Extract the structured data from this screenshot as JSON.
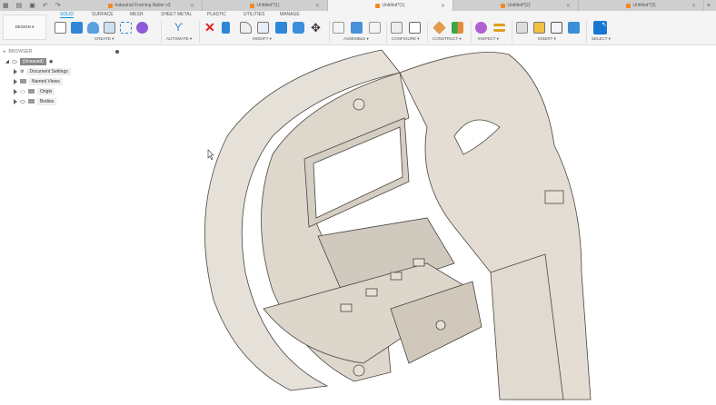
{
  "tabs": [
    {
      "label": "Industrial Framing Nailer v3",
      "active": false
    },
    {
      "label": "Untitled*(1)",
      "active": false
    },
    {
      "label": "Untitled*(1)",
      "active": true
    },
    {
      "label": "Untitled*(2)",
      "active": false
    },
    {
      "label": "Untitled*(3)",
      "active": false
    }
  ],
  "toolbar": {
    "workspace": "DESIGN ▾",
    "tabs": [
      "SOLID",
      "SURFACE",
      "MESH",
      "SHEET METAL",
      "PLASTIC",
      "UTILITIES",
      "MANAGE"
    ],
    "groups": [
      "CREATE ▾",
      "AUTOMATE ▾",
      "MODIFY ▾",
      "ASSEMBLE ▾",
      "CONFIGURE ▾",
      "CONSTRUCT ▾",
      "INSPECT ▾",
      "INSERT ▾",
      "SELECT ▾"
    ]
  },
  "browser": {
    "title": "BROWSER",
    "root": "(Unsaved)",
    "items": [
      "Document Settings",
      "Named Views",
      "Origin",
      "Bodies"
    ]
  }
}
